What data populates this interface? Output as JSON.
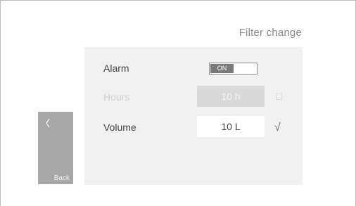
{
  "header": {
    "title": "Filter change"
  },
  "back": {
    "label": "Back",
    "icon": "chevron-left-icon"
  },
  "settings": {
    "alarm": {
      "label": "Alarm",
      "toggle_label": "ON",
      "state": "on"
    },
    "hours": {
      "label": "Hours",
      "value": "10 h",
      "enabled": false,
      "checked": false
    },
    "volume": {
      "label": "Volume",
      "value": "10 L",
      "enabled": true,
      "checked": true,
      "check_glyph": "√"
    }
  },
  "colors": {
    "panel": "#f1f1f1",
    "back_button": "#a7a7a7",
    "toggle_on": "#7a7a7a",
    "disabled_field": "#d9d9d9"
  }
}
